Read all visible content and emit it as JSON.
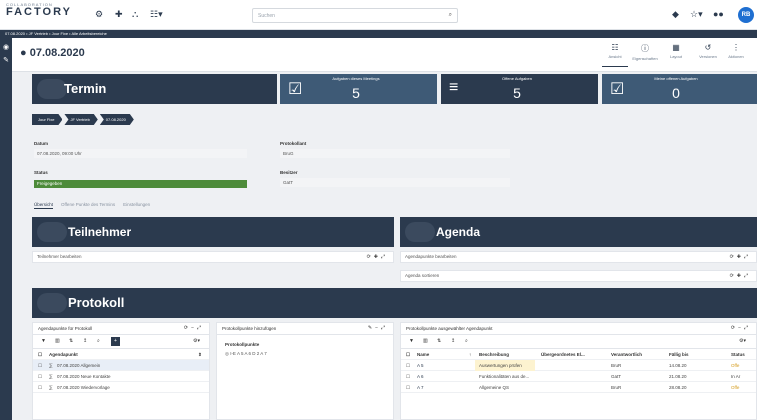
{
  "app": {
    "logo_small": "COLLABORATION",
    "logo_big": "FACTORY"
  },
  "topbar": {
    "icons": [
      "gear-icon",
      "plus-icon",
      "org-icon",
      "grid-icon"
    ],
    "search_placeholder": "Suchen",
    "right_icons": [
      "pin-icon",
      "star-icon",
      "users-icon"
    ],
    "avatar_initials": "RB"
  },
  "crumbbar": {
    "text": "07.08.2020  •  JF Vertrieb  •  Jour Fixe  •  Alle Arbeitsbereiche"
  },
  "page": {
    "title": "07.08.2020"
  },
  "views": [
    {
      "label": "Ansicht",
      "icon": "list-icon",
      "glyph": "☷"
    },
    {
      "label": "Eigenschaften",
      "icon": "info-icon",
      "glyph": "ⓘ"
    },
    {
      "label": "Layout",
      "icon": "layout-icon",
      "glyph": "▦"
    },
    {
      "label": "Versionen",
      "icon": "history-icon",
      "glyph": "↺"
    },
    {
      "label": "Aktionen",
      "icon": "more-icon",
      "glyph": "⋮"
    }
  ],
  "termin": {
    "title": "Termin"
  },
  "tiles": [
    {
      "label": "Aufgaben dieses Meetings",
      "value": "5",
      "icon": "calendar-check-icon",
      "glyph": "☑"
    },
    {
      "label": "Offene Aufgaben",
      "value": "5",
      "icon": "numbered-list-icon",
      "glyph": "≡"
    },
    {
      "label": "Meine offenen Aufgaben",
      "value": "0",
      "icon": "checkbox-icon",
      "glyph": "☑"
    }
  ],
  "breadcrumb": [
    "Jour Fixe",
    "JF Vertrieb",
    "07.08.2020"
  ],
  "fields": {
    "datum_label": "Datum",
    "datum_value": "07.08.2020, 09:00 Uhr",
    "status_label": "Status",
    "status_value": "Freigegeben",
    "protokollant_label": "Protokollant",
    "protokollant_value": "BruG",
    "besitzer_label": "Besitzer",
    "besitzer_value": "GatT"
  },
  "tabs": [
    "Übersicht",
    "Offene Punkte des Termins",
    "Einstellungen"
  ],
  "teilnehmer": {
    "title": "Teilnehmer",
    "edit_label": "Teilnehmer bearbeiten"
  },
  "agenda": {
    "title": "Agenda",
    "edit_label": "Agendapunkte bearbeiten",
    "sort_label": "Agenda sortieren"
  },
  "protokoll": {
    "title": "Protokoll"
  },
  "panel_left": {
    "title": "Agendapunkte für Protokoll",
    "col_header": "Agendapunkt",
    "rows": [
      "07.08.2020 Allgemein",
      "07.08.2020 Neue Kontakte",
      "07.08.2020 Wiedervorlage"
    ]
  },
  "panel_mid": {
    "title": "Protokollpunkte hinzufügen",
    "label": "Protokollpunkte",
    "items": "I-E  A 5  A 6  D 2  A 7"
  },
  "panel_right": {
    "title": "Protokollpunkte ausgewählter Agendapunkt",
    "headers": {
      "name": "Name",
      "desc": "Beschreibung",
      "parent": "Übergeordnetes El...",
      "owner": "Verantwortlich",
      "due": "Fällig bis",
      "status": "Status"
    },
    "rows": [
      {
        "name": "A 5",
        "desc": "Auswertungen prüfen",
        "owner": "BruR",
        "due": "14.08.20",
        "status": "Offe"
      },
      {
        "name": "A 6",
        "desc": "Funktionalitäten aus de...",
        "owner": "GatT",
        "due": "21.08.20",
        "status": "In Ar"
      },
      {
        "name": "A 7",
        "desc": "Allgemeine QS",
        "owner": "BruR",
        "due": "28.08.20",
        "status": "Offe"
      }
    ]
  }
}
